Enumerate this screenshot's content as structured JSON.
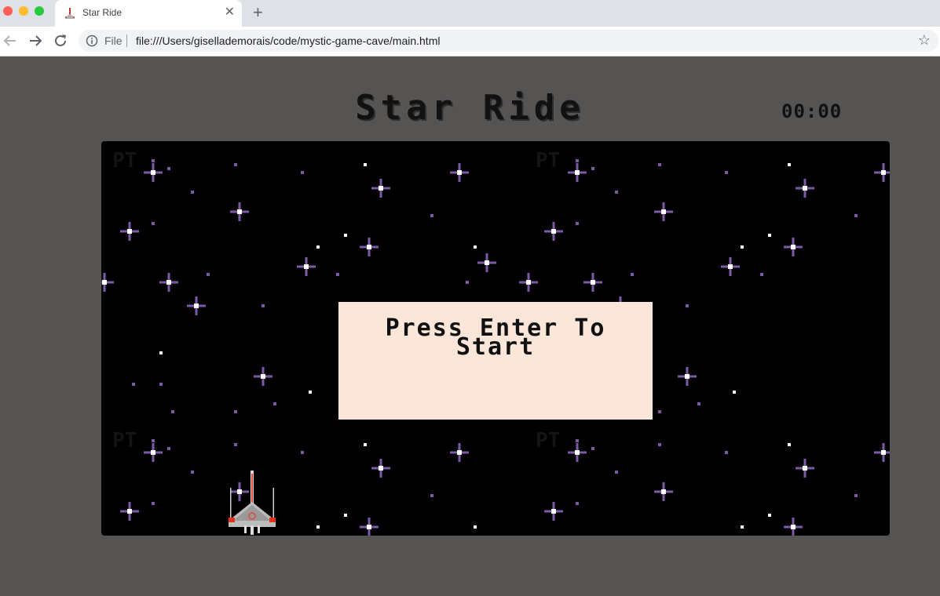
{
  "browser": {
    "tab_title": "Star Ride",
    "new_tab_label": "+",
    "url_scheme": "File",
    "url": "file:///Users/gisellademorais/code/mystic-game-cave/main.html"
  },
  "game": {
    "title": "Star Ride",
    "timer": "00:00",
    "overlay_text": "Press Enter To Start",
    "watermark": "PT"
  },
  "colors": {
    "page_background": "#565353",
    "stage_background": "#000000",
    "overlay_background": "#fbe7da",
    "star_purple": "#7c5aa8",
    "star_white": "#ffffff"
  }
}
